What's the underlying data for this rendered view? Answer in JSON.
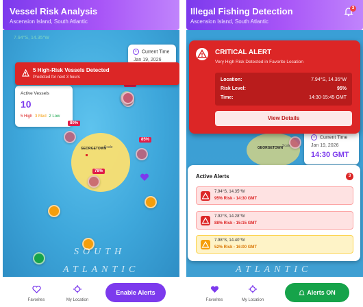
{
  "left": {
    "header": {
      "title": "Vessel Risk Analysis",
      "subtitle": "Ascension Island, South Atlantic"
    },
    "faint_coord": "7.94°S, 14.35°W",
    "time_card": {
      "label": "Current Time",
      "date": "Jan 19, 2026"
    },
    "risk_banner": {
      "title": "5 High-Risk Vessels Detected",
      "subtitle": "Predicted for next 3 hours"
    },
    "active_vessels": {
      "label": "Active Vessels",
      "count": "10",
      "high": "5 High",
      "med": "3 Med",
      "low": "2 Low"
    },
    "map_labels": {
      "town": "GEORGETOWN",
      "scale": "Scale",
      "south": "SOUTH",
      "atlantic": "ATLANTIC"
    },
    "risk_badges": [
      "91%",
      "80%",
      "85%",
      "78%"
    ],
    "nav": {
      "favorites": "Favorites",
      "location": "My Location",
      "cta": "Enable Alerts"
    }
  },
  "right": {
    "header": {
      "title": "Illegal Fishing Detection",
      "subtitle": "Ascension Island, South Atlantic",
      "badge": "3"
    },
    "critical": {
      "title": "CRITICAL ALERT",
      "subtitle": "Very High Risk Detected in Favorite Location",
      "location_label": "Location:",
      "location_value": "7.94°S, 14.35°W",
      "risk_label": "Risk Level:",
      "risk_value": "95%",
      "time_label": "Time:",
      "time_value": "14:30-15:45 GMT",
      "button": "View Details"
    },
    "time_card": {
      "label": "Current Time",
      "date": "Jan 19, 2026",
      "time": "14:30 GMT"
    },
    "map_labels": {
      "town": "GEORGETOWN",
      "scale": "Scale",
      "atlantic": "ATLANTIC"
    },
    "alerts": {
      "title": "Active Alerts",
      "count": "3",
      "items": [
        {
          "coord": "7.94°S, 14.35°W",
          "risk": "95% Risk - 14:30 GMT",
          "color": "#dc2626"
        },
        {
          "coord": "7.92°S, 14.28°W",
          "risk": "88% Risk - 15:15 GMT",
          "color": "#dc2626"
        },
        {
          "coord": "7.98°S, 14.40°W",
          "risk": "52% Risk - 16:00 GMT",
          "color": "#f59e0b"
        }
      ]
    },
    "nav": {
      "favorites": "Favorites",
      "location": "My Location",
      "cta": "Alerts ON"
    }
  },
  "colors": {
    "purple": "#7c3aed",
    "red": "#dc2626",
    "green": "#16a34a",
    "orange": "#f59e0b"
  }
}
